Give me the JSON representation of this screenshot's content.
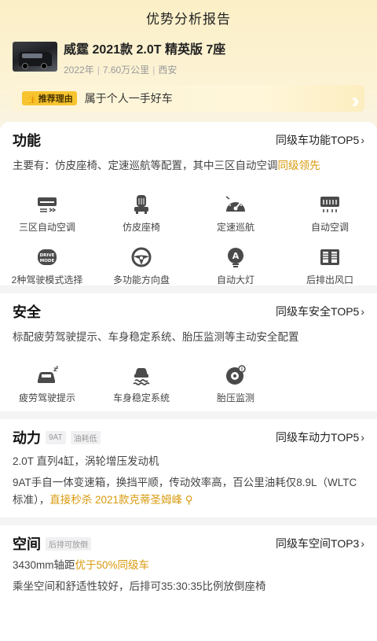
{
  "header": {
    "title": "优势分析报告"
  },
  "car": {
    "name": "威霆 2021款 2.0T 精英版 7座",
    "year": "2022年",
    "mileage": "7.60万公里",
    "city": "西安"
  },
  "reason": {
    "tag": "推荐理由",
    "text": "属于个人一手好车"
  },
  "sections": {
    "function": {
      "title": "功能",
      "link": "同级车功能TOP5",
      "desc_prefix": "主要有：仿皮座椅、定速巡航等配置，其中三区自动空调",
      "desc_highlight": "同级领先",
      "icons": [
        {
          "label": "三区自动空调",
          "icon": "ac-zones-icon"
        },
        {
          "label": "仿皮座椅",
          "icon": "seat-icon"
        },
        {
          "label": "定速巡航",
          "icon": "cruise-icon"
        },
        {
          "label": "自动空调",
          "icon": "auto-ac-icon"
        },
        {
          "label": "2种驾驶模式选择",
          "icon": "drive-mode-icon",
          "badge": "DRIVE MODE"
        },
        {
          "label": "多功能方向盘",
          "icon": "steering-wheel-icon"
        },
        {
          "label": "自动大灯",
          "icon": "headlight-icon",
          "badge": "A"
        },
        {
          "label": "后排出风口",
          "icon": "rear-vent-icon"
        }
      ]
    },
    "safety": {
      "title": "安全",
      "link": "同级车安全TOP5",
      "desc": "标配疲劳驾驶提示、车身稳定系统、胎压监测等主动安全配置",
      "icons": [
        {
          "label": "疲劳驾驶提示",
          "icon": "fatigue-icon"
        },
        {
          "label": "车身稳定系统",
          "icon": "stability-icon"
        },
        {
          "label": "胎压监测",
          "icon": "tire-pressure-icon"
        }
      ]
    },
    "power": {
      "title": "动力",
      "tags": [
        "9AT",
        "油耗低"
      ],
      "link": "同级车动力TOP5",
      "line1": "2.0T 直列4缸，涡轮增压发动机",
      "line2_prefix": "9AT手自一体变速箱，换挡平顺，传动效率高，百公里油耗仅8.9L（WLTC标准），",
      "line2_highlight": "直接秒杀 2021款克蒂圣姆峰"
    },
    "space": {
      "title": "空间",
      "tags": [
        "后排可放倒"
      ],
      "link": "同级车空间TOP3",
      "line1_prefix": "3430mm轴距",
      "line1_highlight": "优于50%同级车",
      "line2": "乘坐空间和舒适性较好，后排可35:30:35比例放倒座椅"
    }
  },
  "colors": {
    "accent": "#d99a0d",
    "tag": "#f7c42f",
    "icon": "#4a4a4a"
  }
}
